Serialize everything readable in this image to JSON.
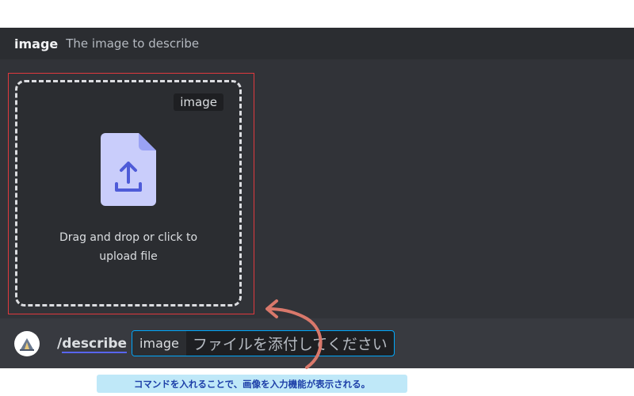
{
  "option_header": {
    "name": "image",
    "description": "The image to describe"
  },
  "dropzone": {
    "tag": "image",
    "icon": "file-upload-icon",
    "line1": "Drag and drop or click to",
    "line2": "upload file"
  },
  "command_bar": {
    "avatar_icon": "bot-avatar-icon",
    "slash": "/",
    "command": "describe",
    "param_name": "image",
    "param_value": "ファイルを添付してください"
  },
  "annotation": {
    "caption": "コマンドを入れることで、画像を入力機能が表示される。",
    "arrow_color": "#d9786b",
    "highlight_color": "#e0393e"
  },
  "colors": {
    "background": "#313338",
    "accent": "#5865f2",
    "focus": "#00a8fc",
    "file_icon": "#c9cdfb"
  }
}
